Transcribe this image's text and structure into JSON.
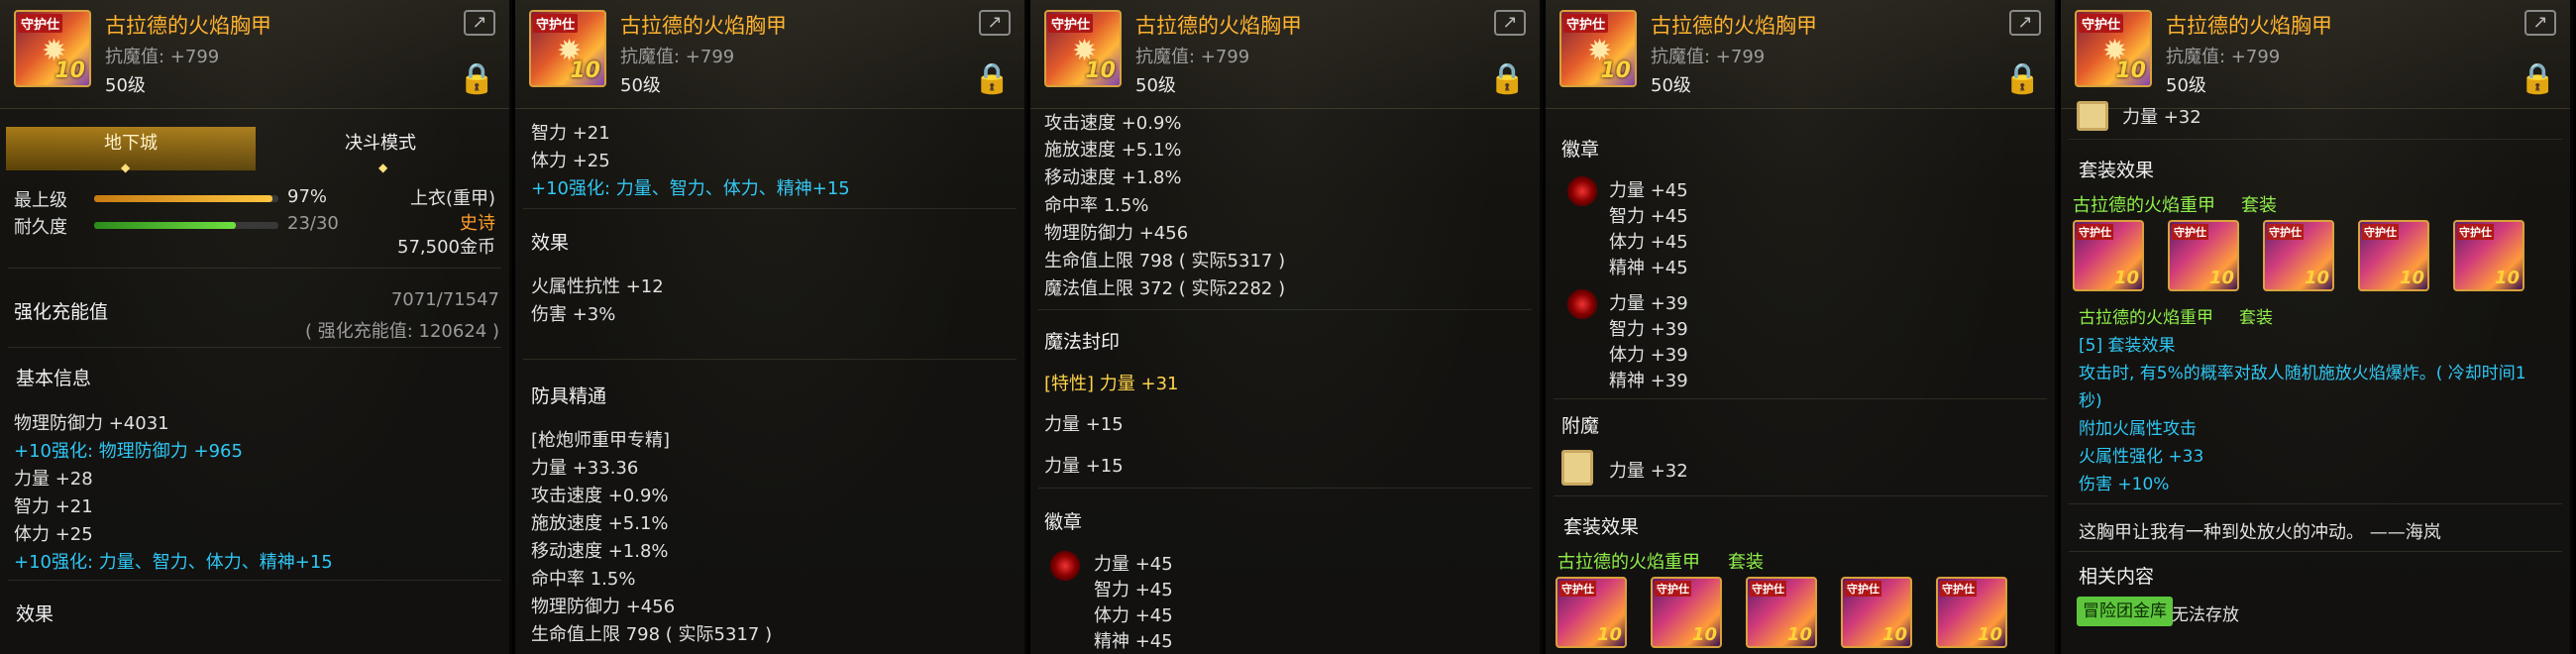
{
  "item": {
    "name": "古拉德的火焰胸甲",
    "resist": "抗魔值: +799",
    "level": "50级",
    "tag": "守护仕",
    "enh": "10"
  },
  "p1": {
    "tabs": [
      "地下城",
      "决斗模式"
    ],
    "grade_label": "最上级",
    "grade_pct": "97%",
    "dur_label": "耐久度",
    "dur_val": "23/30",
    "grade_fill": 0.97,
    "dur_fill": 0.767,
    "slot": "上衣(重甲)",
    "rarity": "史诗",
    "price": "57,500金币",
    "charge_label": "强化充能值",
    "charge_val": "7071/71547",
    "charge_sub": "( 强化充能值: 120624 )",
    "basic": "基本信息",
    "l1": "物理防御力 +4031",
    "l2": "+10强化: 物理防御力 +965",
    "l3": "力量 +28",
    "l4": "智力 +21",
    "l5": "体力 +25",
    "l6": "+10强化: 力量、智力、体力、精神+15",
    "effect": "效果"
  },
  "p2": {
    "l1": "智力 +21",
    "l2": "体力 +25",
    "l3": "+10强化: 力量、智力、体力、精神+15",
    "effect": "效果",
    "e1": "火属性抗性 +12",
    "e2": "伤害 +3%",
    "mastery": "防具精通",
    "m0": "[枪炮师重甲专精]",
    "m1": "力量 +33.36",
    "m2": "攻击速度 +0.9%",
    "m3": "施放速度 +5.1%",
    "m4": "移动速度 +1.8%",
    "m5": "命中率 1.5%",
    "m6": "物理防御力 +456",
    "m7": "生命值上限 798 ( 实际5317 )"
  },
  "p3": {
    "l1": "攻击速度 +0.9%",
    "l2": "施放速度 +5.1%",
    "l3": "移动速度 +1.8%",
    "l4": "命中率 1.5%",
    "l5": "物理防御力 +456",
    "l6": "生命值上限 798 ( 实际5317 )",
    "l7": "魔法值上限 372 ( 实际2282 )",
    "seal": "魔法封印",
    "s1": "[特性] 力量 +31",
    "s2": "力量 +15",
    "s3": "力量 +15",
    "emblem": "徽章",
    "b1": "力量 +45",
    "b2": "智力 +45",
    "b3": "体力 +45",
    "b4": "精神 +45"
  },
  "p4": {
    "emblem": "徽章",
    "a1": "力量 +45",
    "a2": "智力 +45",
    "a3": "体力 +45",
    "a4": "精神 +45",
    "c1": "力量 +39",
    "c2": "智力 +39",
    "c3": "体力 +39",
    "c4": "精神 +39",
    "enchant": "附魔",
    "en1": "力量 +32",
    "setfx": "套装效果",
    "setname": "古拉德的火焰重甲",
    "settag": "套装"
  },
  "p5": {
    "top": "力量 +32",
    "setfx": "套装效果",
    "setname": "古拉德的火焰重甲",
    "settag": "套装",
    "sub": "古拉德的火焰重甲",
    "subtag": "套装",
    "five": "[5] 套装效果",
    "d1": "攻击时, 有5%的概率对敌人随机施放火焰爆炸。( 冷却时间1",
    "d2": "秒)",
    "d3": "附加火属性攻击",
    "d4": "火属性强化 +33",
    "d5": "伤害 +10%",
    "flavor": "这胸甲让我有一种到处放火的冲动。 ——海岚",
    "related": "相关内容",
    "btn": "冒险团金库",
    "nostore": "无法存放"
  },
  "icons": [
    "share-icon",
    "lock-icon",
    "emblem-icon",
    "enchant-card-icon",
    "diamond-icon"
  ]
}
